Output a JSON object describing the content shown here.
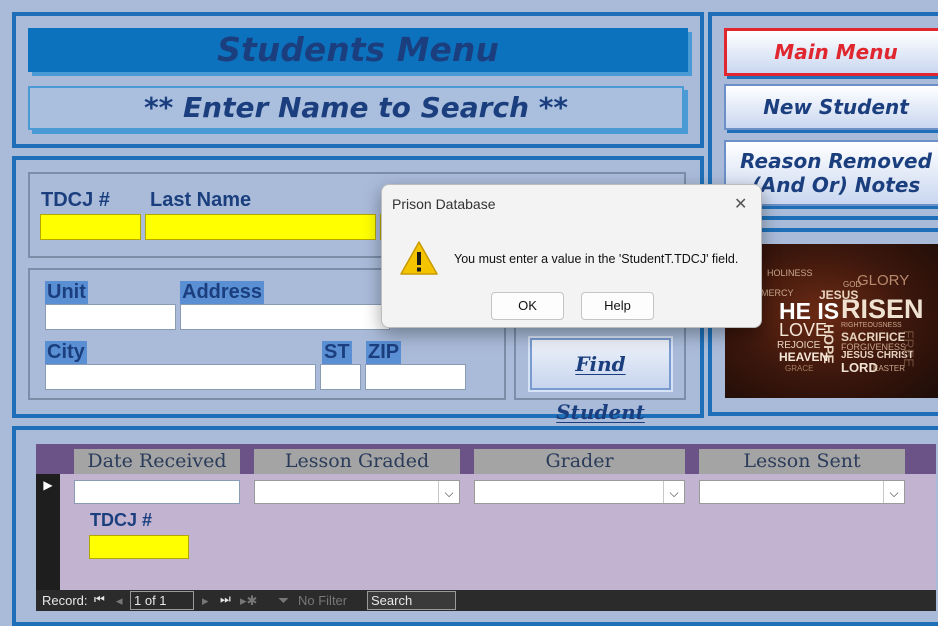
{
  "header": {
    "title": "Students Menu",
    "subtitle": "** Enter Name to Search **"
  },
  "nav": {
    "main_menu": "Main Menu",
    "new_student": "New Student",
    "reason_line1": "Reason Removed",
    "reason_line2": "(And Or) Notes"
  },
  "search_form": {
    "tdcj_label": "TDCJ #",
    "last_name_label": "Last Name",
    "unit_label": "Unit",
    "address_label": "Address",
    "city_label": "City",
    "st_label": "ST",
    "zip_label": "ZIP",
    "find_button": "Find Student",
    "find_button_accel": "F"
  },
  "image_words": {
    "w1": "HE IS",
    "w2": "RISEN",
    "w3": "GLORY",
    "w4": "JESUS",
    "w5": "LOVE",
    "w6": "HOPE",
    "w7": "HEAVEN",
    "w8": "REJOICE",
    "w9": "SACRIFICE",
    "w10": "JESUS CHRIST",
    "w11": "LORD",
    "w12": "HOLINESS",
    "w13": "MERCY",
    "w14": "FORGIVENESS",
    "w15": "RIGHTEOUSNESS",
    "w16": "EASTER",
    "w17": "GRACE",
    "w18": "GOD",
    "w19": "FREE"
  },
  "subform": {
    "columns": [
      "Date Received",
      "Lesson Graded",
      "Grader",
      "Lesson Sent"
    ],
    "row_tdcj_label": "TDCJ #"
  },
  "record_nav": {
    "record_label": "Record:",
    "position": "1 of 1",
    "filter_label": "No Filter",
    "search_label": "Search"
  },
  "dialog": {
    "title": "Prison Database",
    "message": "You must enter a value in the 'StudentT.TDCJ' field.",
    "ok": "OK",
    "help": "Help",
    "close_glyph": "✕"
  },
  "colors": {
    "field_required": "#ffff00",
    "panel_border": "#1e6fb8",
    "main_menu_border": "#e0262f",
    "main_menu_text": "#e0262f"
  }
}
